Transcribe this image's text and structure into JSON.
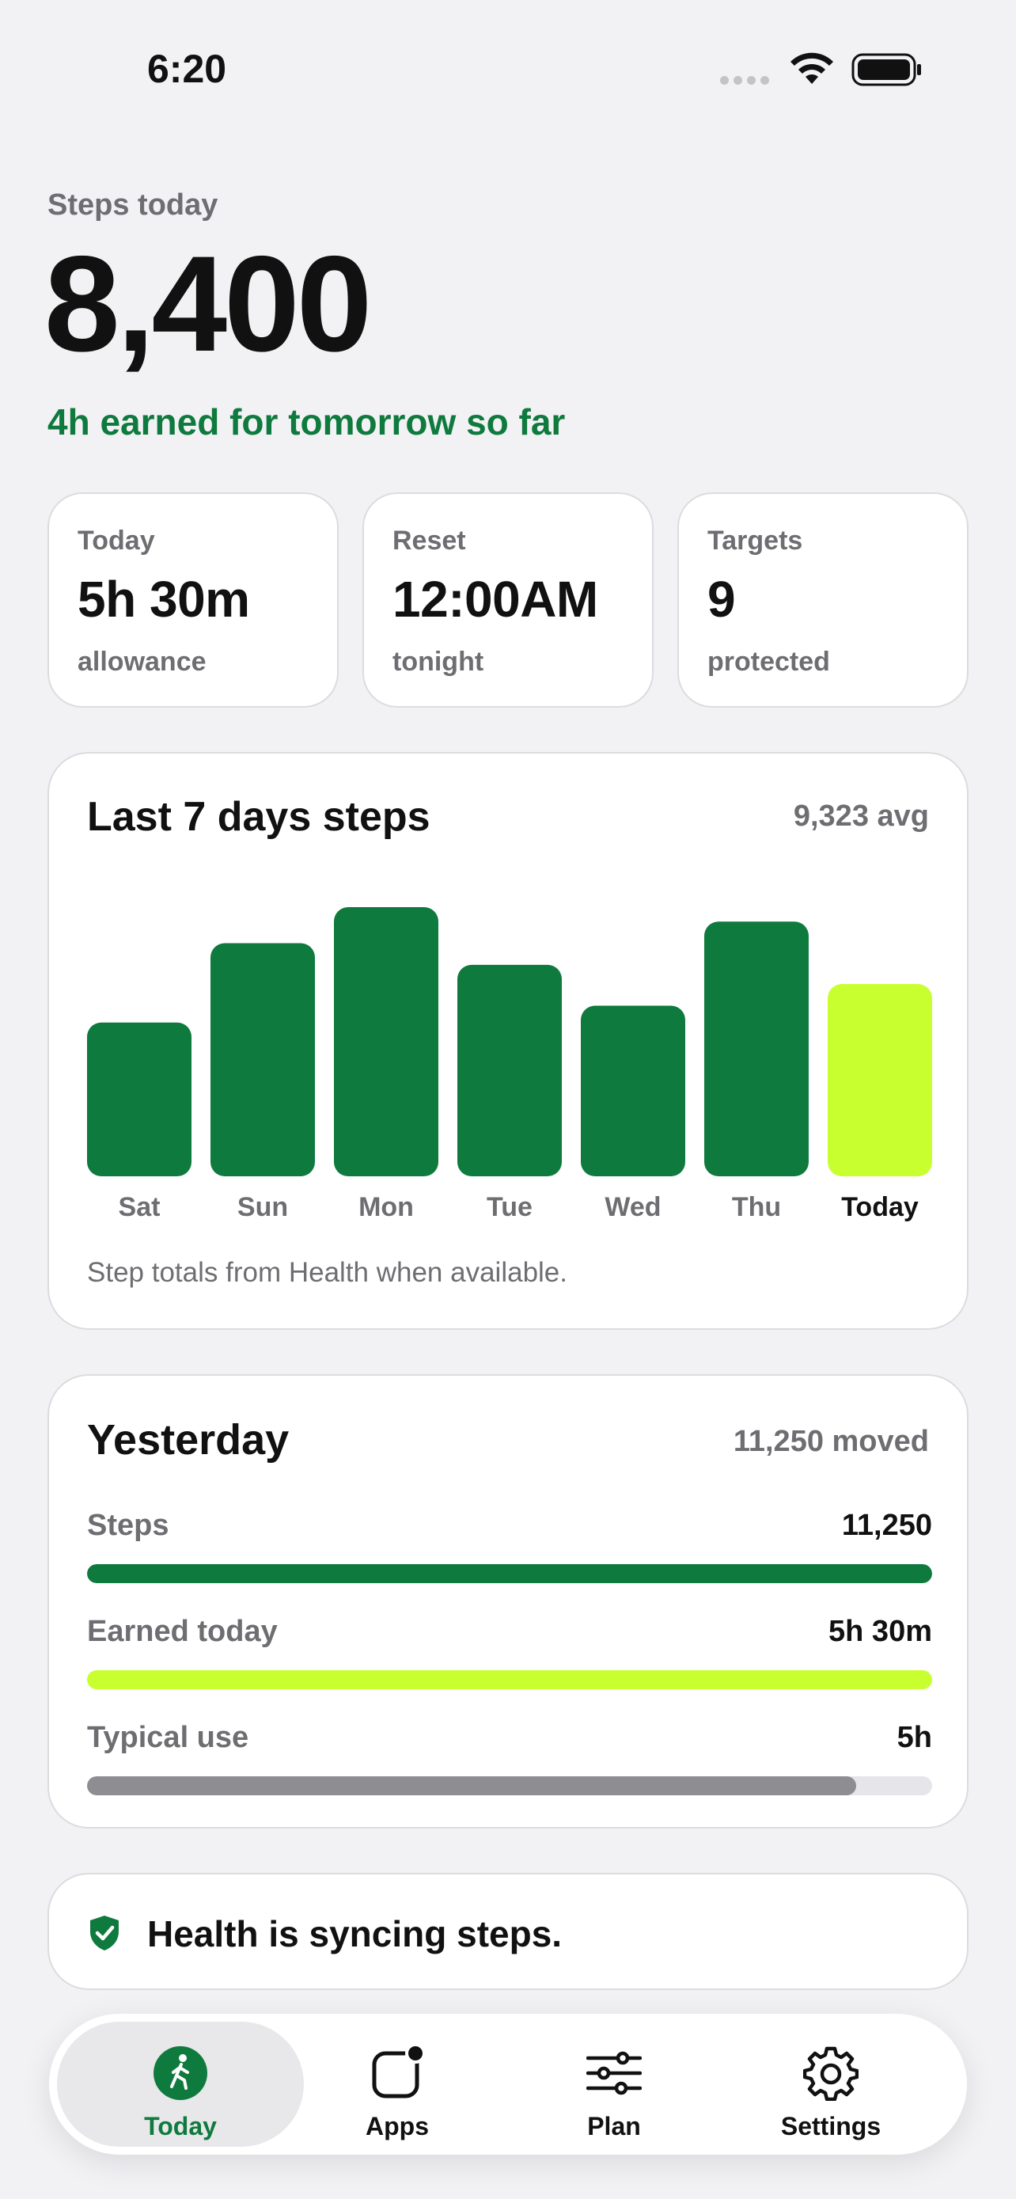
{
  "status_bar": {
    "time": "6:20"
  },
  "header": {
    "label": "Steps today",
    "steps": "8,400",
    "earned": "4h earned for tomorrow so far"
  },
  "stat_cards": [
    {
      "label": "Today",
      "value": "5h 30m",
      "sub": "allowance"
    },
    {
      "label": "Reset",
      "value": "12:00AM",
      "sub": "tonight"
    },
    {
      "label": "Targets",
      "value": "9",
      "sub": "protected"
    }
  ],
  "weekly_card": {
    "title": "Last 7 days steps",
    "avg": "9,323 avg",
    "note": "Step totals from Health when available."
  },
  "chart_data": {
    "type": "bar",
    "title": "Last 7 days steps",
    "categories": [
      "Sat",
      "Sun",
      "Mon",
      "Tue",
      "Wed",
      "Thu",
      "Today"
    ],
    "values": [
      6400,
      9700,
      11200,
      8800,
      7100,
      10600,
      8000
    ],
    "highlight_index": 6,
    "colors": {
      "bar": "#0f7a3e",
      "highlight": "#c8ff2e"
    },
    "ylim": [
      0,
      11200
    ]
  },
  "yesterday": {
    "title": "Yesterday",
    "summary": "11,250 moved",
    "metrics": [
      {
        "label": "Steps",
        "value": "11,250",
        "fraction": 1.0,
        "color": "#0f7a3e"
      },
      {
        "label": "Earned today",
        "value": "5h 30m",
        "fraction": 1.0,
        "color": "#c8ff2e"
      },
      {
        "label": "Typical use",
        "value": "5h",
        "fraction": 0.91,
        "color": "#8e8e92"
      }
    ]
  },
  "sync": {
    "text": "Health is syncing steps."
  },
  "tabs": [
    {
      "label": "Today",
      "icon": "walking-figure-icon",
      "active": true
    },
    {
      "label": "Apps",
      "icon": "apps-square-icon",
      "active": false
    },
    {
      "label": "Plan",
      "icon": "sliders-icon",
      "active": false
    },
    {
      "label": "Settings",
      "icon": "gear-icon",
      "active": false
    }
  ],
  "colors": {
    "accent": "#0f7a3e",
    "highlight": "#c8ff2e",
    "muted": "#6e6e72",
    "background": "#f2f2f5"
  }
}
